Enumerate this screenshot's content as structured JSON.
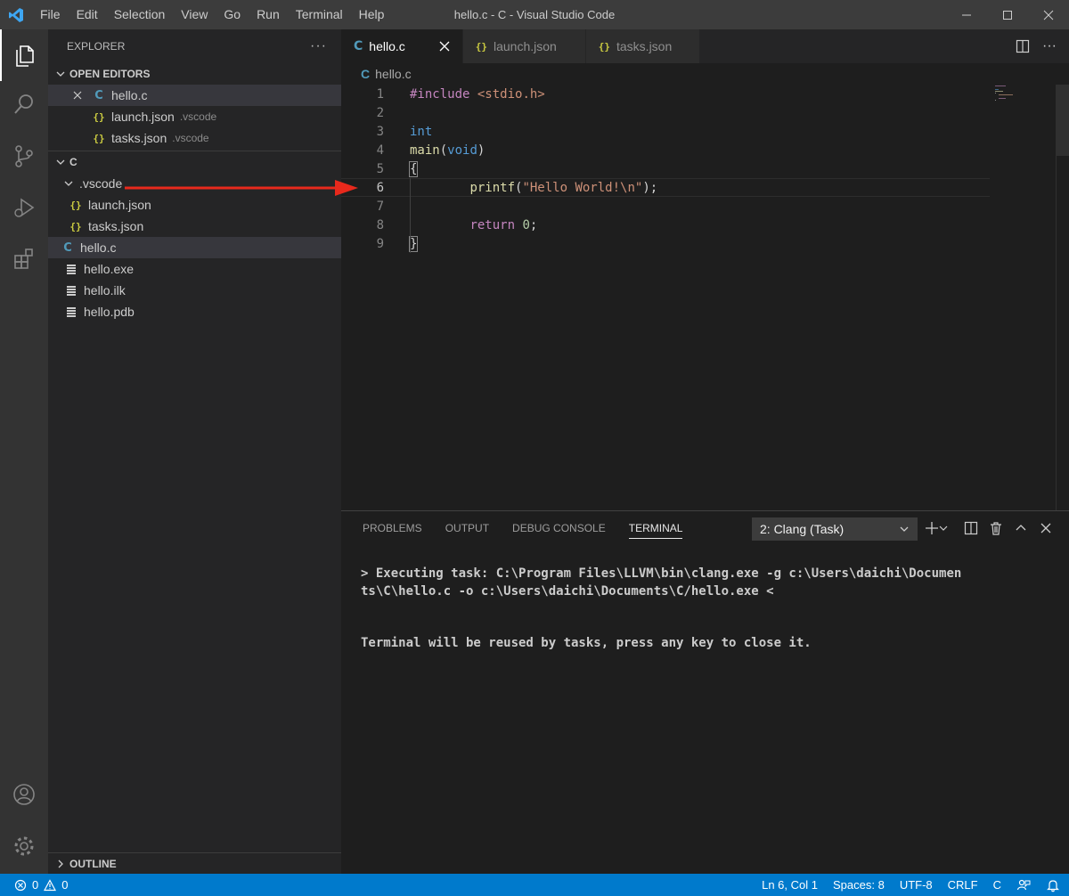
{
  "window": {
    "title": "hello.c - C - Visual Studio Code",
    "menu": [
      "File",
      "Edit",
      "Selection",
      "View",
      "Go",
      "Run",
      "Terminal",
      "Help"
    ]
  },
  "sidebar": {
    "header": "EXPLORER",
    "open_editors": {
      "label": "OPEN EDITORS",
      "items": [
        {
          "icon": "C",
          "name": "hello.c",
          "desc": ""
        },
        {
          "icon": "{}",
          "name": "launch.json",
          "desc": ".vscode"
        },
        {
          "icon": "{}",
          "name": "tasks.json",
          "desc": ".vscode"
        }
      ]
    },
    "folder": {
      "label": "C",
      "items": [
        {
          "name": ".vscode"
        },
        {
          "icon": "{}",
          "name": "launch.json"
        },
        {
          "icon": "{}",
          "name": "tasks.json"
        },
        {
          "icon": "C",
          "name": "hello.c"
        },
        {
          "name": "hello.exe"
        },
        {
          "name": "hello.ilk"
        },
        {
          "name": "hello.pdb"
        }
      ]
    },
    "outline_label": "OUTLINE"
  },
  "tabs": [
    {
      "icon": "C",
      "label": "hello.c",
      "active": true
    },
    {
      "icon": "{}",
      "label": "launch.json",
      "active": false
    },
    {
      "icon": "{}",
      "label": "tasks.json",
      "active": false
    }
  ],
  "breadcrumb": {
    "icon": "C",
    "file": "hello.c"
  },
  "editor": {
    "line_numbers": [
      "1",
      "2",
      "3",
      "4",
      "5",
      "6",
      "7",
      "8",
      "9"
    ],
    "current_line": 6,
    "code": {
      "l1_directive": "#include",
      "l1_header": "<stdio.h>",
      "l3_type": "int",
      "l4_name": "main",
      "l4_open": "(",
      "l4_param": "void",
      "l4_close": ")",
      "l5": "{",
      "l6_fn": "printf",
      "l6_open": "(",
      "l6_str": "\"Hello World!\\n\"",
      "l6_close": ");",
      "l8_kw": "return",
      "l8_num": "0",
      "l8_semi": ";",
      "l9": "}"
    }
  },
  "panel": {
    "tabs": [
      "PROBLEMS",
      "OUTPUT",
      "DEBUG CONSOLE",
      "TERMINAL"
    ],
    "active_tab": "TERMINAL",
    "terminal_select": "2: Clang (Task)",
    "terminal_lines": [
      "> Executing task: C:\\Program Files\\LLVM\\bin\\clang.exe -g c:\\Users\\daichi\\Documen",
      "ts\\C\\hello.c -o c:\\Users\\daichi\\Documents\\C/hello.exe <",
      "",
      "Terminal will be reused by tasks, press any key to close it."
    ]
  },
  "statusbar": {
    "errors": "0",
    "warnings": "0",
    "position": "Ln 6, Col 1",
    "spaces": "Spaces: 8",
    "encoding": "UTF-8",
    "eol": "CRLF",
    "language": "C"
  },
  "colors": {
    "accent": "#007acc",
    "annotation_arrow": "#e8291c",
    "c_icon": "#519aba",
    "json_icon": "#cbcb41"
  }
}
